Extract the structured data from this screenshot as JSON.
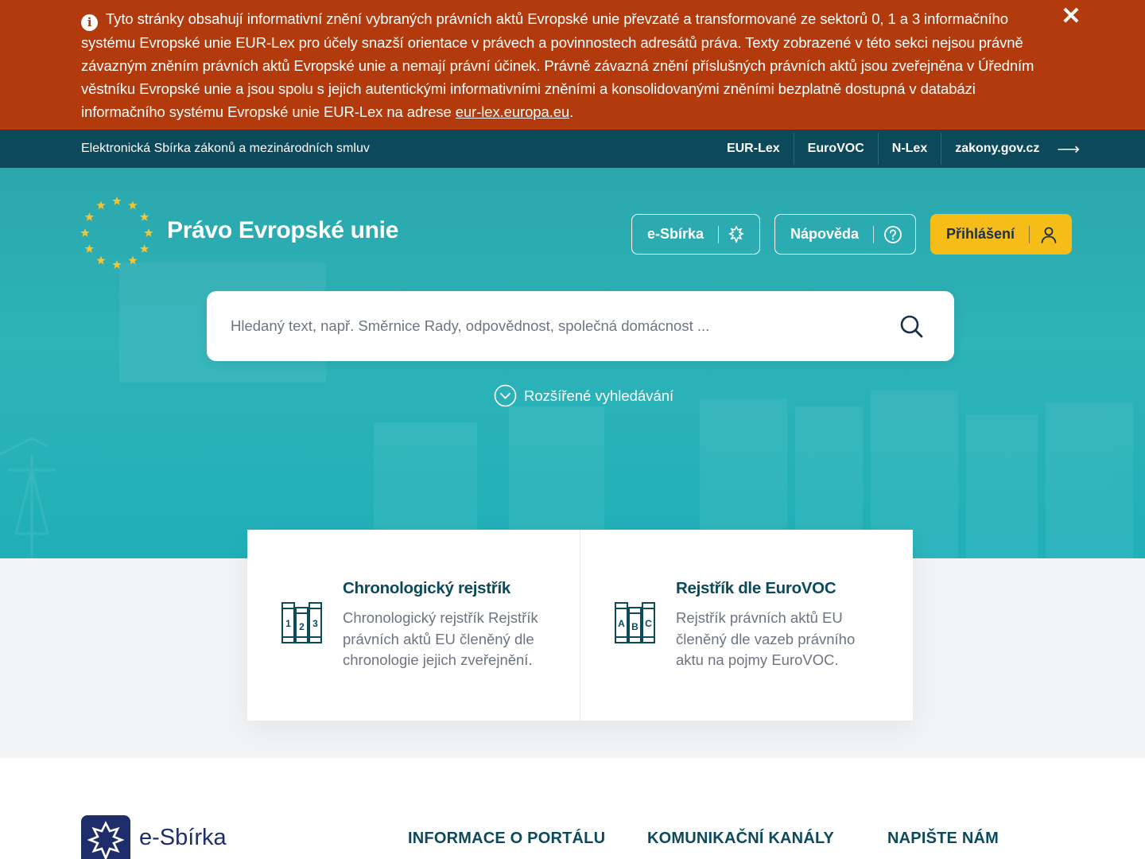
{
  "notice": {
    "text": "Tyto stránky obsahují informativní znění vybraných právních aktů Evropské unie převzaté a transformované ze sektorů 0, 1 a 3 informačního systému Evropské unie EUR-Lex pro účely snazší orientace v právech a povinnostech adresátů práva. Texty zobrazené v této sekci nejsou právně závazným zněním právních aktů Evropské unie a nemají právní účinek. Právně závazná znění příslušných právních aktů jsou zveřejněna v Úředním věstníku Evropské unie a jsou spolu s jejich autentickými informativními zněními a konsolidovanými zněními bezplatně dostupná v databázi informačního systému Evropské unie EUR-Lex na adrese ",
    "link": "eur-lex.europa.eu",
    "link_suffix": ".",
    "info_icon": "info-icon",
    "close_icon": "close-icon",
    "close_glyph": "✕",
    "info_glyph": "i"
  },
  "topbar": {
    "title": "Elektronická Sbírka zákonů a mezinárodních smluv",
    "links": [
      "EUR-Lex",
      "EuroVOC",
      "N-Lex",
      "zakony.gov.cz"
    ],
    "arrow_glyph": "⟶"
  },
  "header": {
    "brand": "Právo Evropské unie",
    "buttons": {
      "esbirka": "e-Sbírka",
      "help": "Nápověda",
      "login": "Přihlášení"
    }
  },
  "search": {
    "placeholder": "Hledaný text, např. Směrnice Rady, odpovědnost, společná domácnost ...",
    "value": ""
  },
  "advanced_search": "Rozšířené vyhledávání",
  "cards": [
    {
      "title": "Chronologický rejstřík",
      "description": "Chronologický rejstřík Rejstřík právních aktů EU členěný dle chronologie jejich zveřejnění.",
      "icon": "chronological-register-icon",
      "icon_labels": [
        "1",
        "2",
        "3"
      ]
    },
    {
      "title": "Rejstřík dle EuroVOC",
      "description": "Rejstřík právních aktů EU členěný dle vazeb právního aktu na pojmy EuroVOC.",
      "icon": "eurovoc-register-icon",
      "icon_labels": [
        "A",
        "B",
        "C"
      ]
    }
  ],
  "footer": {
    "brand": "e-Sbírka",
    "headings": [
      "INFORMACE O PORTÁLU",
      "KOMUNIKAČNÍ KANÁLY",
      "NAPIŠTE NÁM"
    ]
  },
  "colors": {
    "notice_bg": "#b23a0c",
    "topbar_bg": "#0c4a5b",
    "hero_bg": "#2aa7ad",
    "login_button": "#f6bd18",
    "eu_star": "#f6c531",
    "brand_dark": "#1e2d6b"
  }
}
